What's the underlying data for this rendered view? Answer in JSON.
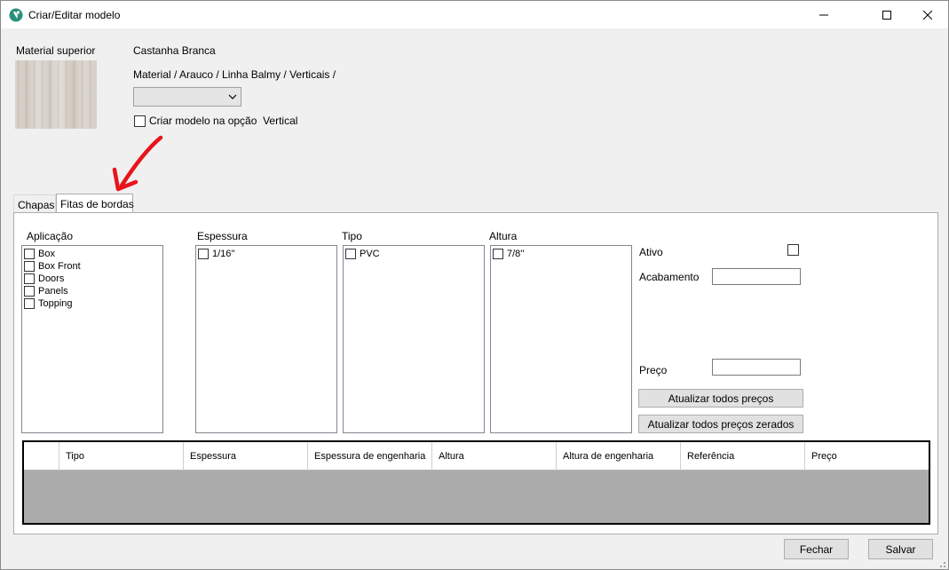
{
  "window": {
    "title": "Criar/Editar modelo",
    "minimize_glyph": "—",
    "maximize_glyph": "☐",
    "close_glyph": "✕"
  },
  "header": {
    "material_label": "Material superior",
    "material_name": "Castanha Branca",
    "material_path": "Material / Arauco / Linha Balmy / Verticais /",
    "combo_value": "",
    "create_vertical_label": "Criar modelo na opção  Vertical",
    "create_vertical_checked": false
  },
  "tabs": [
    {
      "label": "Chapas",
      "active": false
    },
    {
      "label": "Fitas de bordas",
      "active": true
    }
  ],
  "filters": {
    "aplicacao": {
      "label": "Aplicação",
      "items": [
        "Box",
        "Box Front",
        "Doors",
        "Panels",
        "Topping"
      ]
    },
    "espessura": {
      "label": "Espessura",
      "items": [
        "1/16''"
      ]
    },
    "tipo": {
      "label": "Tipo",
      "items": [
        "PVC"
      ]
    },
    "altura": {
      "label": "Altura",
      "items": [
        "7/8''"
      ]
    }
  },
  "properties": {
    "ativo_label": "Ativo",
    "ativo_checked": false,
    "acabamento_label": "Acabamento",
    "acabamento_value": "",
    "preco_label": "Preço",
    "preco_value": "",
    "update_all_label": "Atualizar todos preços",
    "update_zeroed_label": "Atualizar todos preços zerados"
  },
  "grid": {
    "columns": [
      "",
      "Tipo",
      "Espessura",
      "Espessura de engenharia",
      "Altura",
      "Altura de engenharia",
      "Referência",
      "Preço"
    ],
    "rows": []
  },
  "footer": {
    "close_label": "Fechar",
    "save_label": "Salvar"
  },
  "colors": {
    "accent_arrow": "#e8141b",
    "grid_empty": "#ababab"
  }
}
